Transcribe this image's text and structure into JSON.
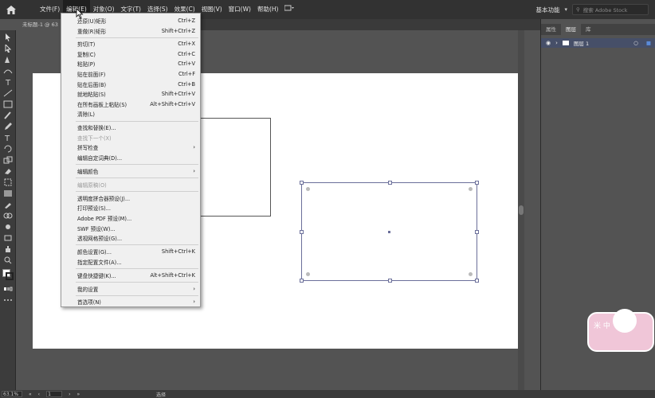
{
  "menubar": {
    "items": [
      "文件(F)",
      "编辑(E)",
      "对象(O)",
      "文字(T)",
      "选择(S)",
      "效果(C)",
      "视图(V)",
      "窗口(W)",
      "帮助(H)"
    ],
    "workspace": "基本功能",
    "search_placeholder": "搜索 Adobe Stock"
  },
  "document": {
    "tab_label": "未标题-1 @ 63"
  },
  "edit_menu": {
    "items": [
      {
        "label": "还原(U)矩形",
        "shortcut": "Ctrl+Z"
      },
      {
        "label": "重做(R)矩形",
        "shortcut": "Shift+Ctrl+Z"
      },
      {
        "label": "剪切(T)",
        "shortcut": "Ctrl+X"
      },
      {
        "label": "复制(C)",
        "shortcut": "Ctrl+C"
      },
      {
        "label": "粘贴(P)",
        "shortcut": "Ctrl+V"
      },
      {
        "label": "贴在前面(F)",
        "shortcut": "Ctrl+F"
      },
      {
        "label": "贴在后面(B)",
        "shortcut": "Ctrl+B"
      },
      {
        "label": "就地粘贴(S)",
        "shortcut": "Shift+Ctrl+V"
      },
      {
        "label": "在所有画板上粘贴(S)",
        "shortcut": "Alt+Shift+Ctrl+V"
      },
      {
        "label": "清除(L)",
        "shortcut": ""
      },
      {
        "label": "查找和替换(E)...",
        "shortcut": ""
      },
      {
        "label": "查找下一个(X)",
        "shortcut": ""
      },
      {
        "label": "拼写检查",
        "shortcut": ""
      },
      {
        "label": "编辑自定词典(D)...",
        "shortcut": ""
      },
      {
        "label": "编辑颜色",
        "shortcut": ""
      },
      {
        "label": "编辑原稿(O)",
        "shortcut": ""
      },
      {
        "label": "透明度拼合器预设(J)...",
        "shortcut": ""
      },
      {
        "label": "打印预设(S)...",
        "shortcut": ""
      },
      {
        "label": "Adobe PDF 预设(M)...",
        "shortcut": ""
      },
      {
        "label": "SWF 预设(W)...",
        "shortcut": ""
      },
      {
        "label": "透视网格预设(G)...",
        "shortcut": ""
      },
      {
        "label": "颜色设置(G)...",
        "shortcut": "Shift+Ctrl+K"
      },
      {
        "label": "指定配置文件(A)...",
        "shortcut": ""
      },
      {
        "label": "键盘快捷键(K)...",
        "shortcut": "Alt+Shift+Ctrl+K"
      },
      {
        "label": "我的设置",
        "shortcut": ""
      },
      {
        "label": "首选项(N)",
        "shortcut": ""
      }
    ]
  },
  "panel": {
    "tabs": [
      "属性",
      "图层",
      "库"
    ],
    "layer_name": "图层 1"
  },
  "statusbar": {
    "zoom": "63.1%",
    "page": "1",
    "tool": "选择"
  },
  "sticker": {
    "text": "米 中"
  },
  "colors": {
    "menubar": "#323232",
    "canvas_bg": "#535353",
    "artboard": "#ffffff",
    "selection": "#6b6f9a",
    "layer_highlight": "#464f68"
  }
}
